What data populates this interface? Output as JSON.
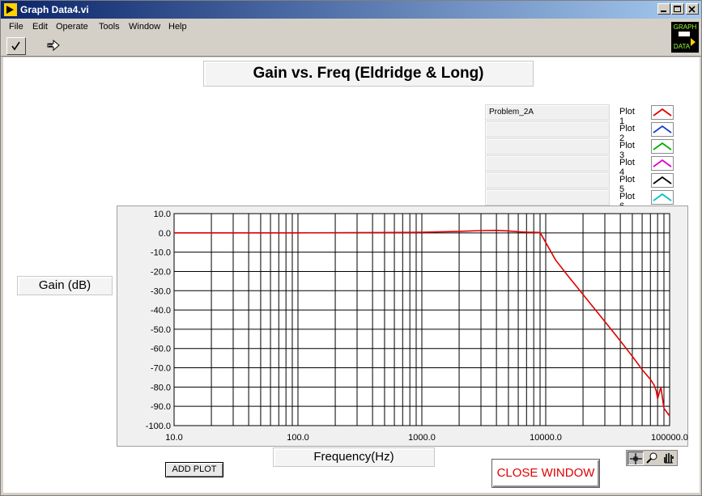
{
  "window": {
    "title": "Graph Data4.vi",
    "controls": {
      "minimize": "minimize-icon",
      "maximize": "maximize-icon",
      "close": "close-icon"
    }
  },
  "menu": [
    "File",
    "Edit",
    "Operate",
    "Tools",
    "Window",
    "Help"
  ],
  "toolbar": {
    "run_icon": "checkmark-icon",
    "run_continuous_icon": "run-arrow-icon"
  },
  "vi_icon": {
    "line1": "GRAPH",
    "line2": "DATA"
  },
  "graph": {
    "title": "Gain vs. Freq (Eldridge & Long)",
    "ylabel": "Gain (dB)",
    "xlabel": "Frequency(Hz)"
  },
  "legend": [
    {
      "name": "Problem_2A",
      "label": "Plot 1",
      "color": "#e00000"
    },
    {
      "name": "",
      "label": "Plot 2",
      "color": "#1a3fd0"
    },
    {
      "name": "",
      "label": "Plot 3",
      "color": "#00b000"
    },
    {
      "name": "",
      "label": "Plot 4",
      "color": "#e000c8"
    },
    {
      "name": "",
      "label": "Plot 5",
      "color": "#000000"
    },
    {
      "name": "",
      "label": "Plot 6",
      "color": "#00c0d0"
    }
  ],
  "buttons": {
    "add_plot": "ADD PLOT",
    "close_window": "CLOSE WINDOW"
  },
  "palette": [
    "crosshair-icon",
    "zoom-icon",
    "pan-hand-icon"
  ],
  "chart_data": {
    "type": "line",
    "title": "Gain vs. Freq (Eldridge & Long)",
    "xlabel": "Frequency(Hz)",
    "ylabel": "Gain (dB)",
    "xscale": "log",
    "xlim": [
      10,
      100000
    ],
    "ylim": [
      -100,
      10
    ],
    "xticks": [
      "10.0",
      "100.0",
      "1000.0",
      "10000.0",
      "100000.0"
    ],
    "yticks": [
      "10.0",
      "0.0",
      "-10.0",
      "-20.0",
      "-30.0",
      "-40.0",
      "-50.0",
      "-60.0",
      "-70.0",
      "-80.0",
      "-90.0",
      "-100.0"
    ],
    "grid": true,
    "series": [
      {
        "name": "Problem_2A",
        "color": "#e00000",
        "x": [
          10,
          100,
          1000,
          2000,
          3000,
          4000,
          5000,
          6000,
          7000,
          8000,
          9000,
          10000,
          12000,
          15000,
          20000,
          30000,
          40000,
          50000,
          60000,
          70000,
          75000,
          78000,
          80000,
          85000,
          90000,
          100000
        ],
        "y": [
          0,
          0,
          0.3,
          0.8,
          1.2,
          1.3,
          1.0,
          0.6,
          0.4,
          0.3,
          0.2,
          -5,
          -14,
          -22,
          -32,
          -46,
          -56,
          -64,
          -71,
          -76,
          -79,
          -82,
          -86,
          -80,
          -91,
          -95
        ]
      }
    ]
  }
}
